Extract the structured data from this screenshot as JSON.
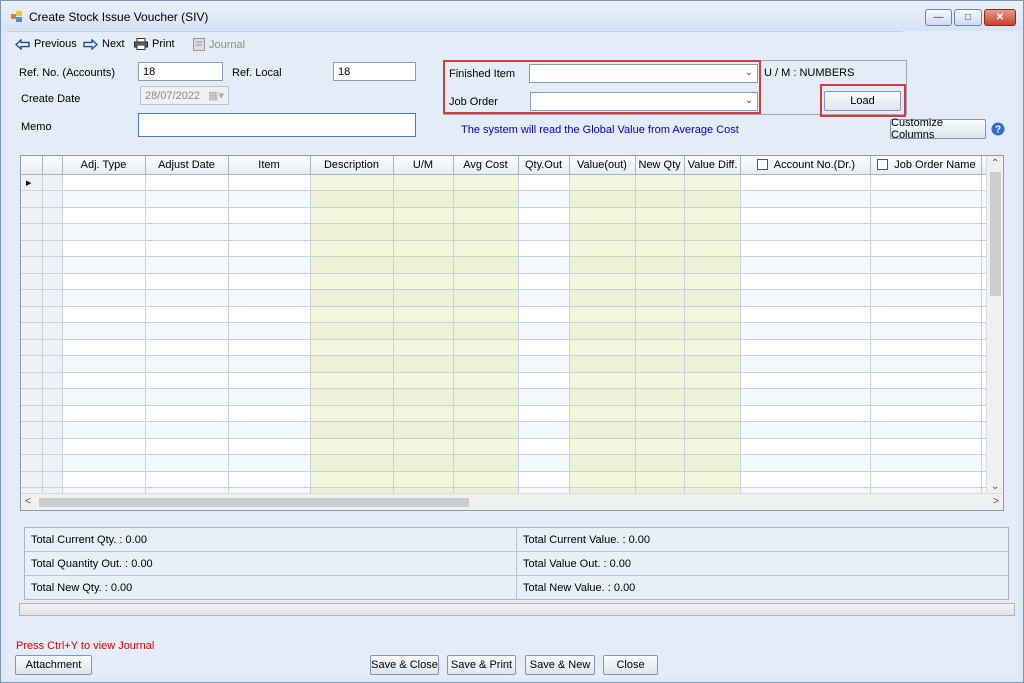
{
  "window": {
    "title": "Create Stock Issue Voucher (SIV)"
  },
  "toolbar": {
    "previous": "Previous",
    "next": "Next",
    "print": "Print",
    "journal": "Journal"
  },
  "form": {
    "ref_no_label": "Ref. No. (Accounts)",
    "ref_no_value": "18",
    "ref_local_label": "Ref. Local",
    "ref_local_value": "18",
    "create_date_label": "Create Date",
    "create_date_value": "28/07/2022",
    "memo_label": "Memo",
    "memo_value": "",
    "finished_item_label": "Finished Item",
    "finished_item_value": "",
    "job_order_label": "Job Order",
    "job_order_value": "",
    "um_text": "U / M : NUMBERS",
    "load_button": "Load",
    "info_text": "The system will read the Global Value from Average Cost",
    "customize_columns": "Customize Columns"
  },
  "grid": {
    "columns": [
      "",
      "",
      "Adj. Type",
      "Adjust Date",
      "Item",
      "Description",
      "U/M",
      "Avg Cost",
      "Qty.Out",
      "Value(out)",
      "New Qty",
      "Value Diff.",
      "Account No.(Dr.)",
      "Job Order Name",
      ""
    ],
    "row_count": 20
  },
  "totals": {
    "current_qty": "Total Current Qty. : 0.00",
    "quantity_out": "Total Quantity Out. : 0.00",
    "new_qty": "Total New Qty. : 0.00",
    "current_value": "Total Current Value. : 0.00",
    "value_out": "Total Value Out. : 0.00",
    "new_value": "Total New Value. : 0.00"
  },
  "footer": {
    "hint": "Press Ctrl+Y to view Journal",
    "attachment": "Attachment",
    "save_close": "Save & Close",
    "save_print": "Save & Print",
    "save_new": "Save & New",
    "close": "Close"
  },
  "colors": {
    "highlight_red": "#d9393b",
    "info_blue": "#0000cc",
    "hint_red": "#e00000",
    "tint_column": "#f3f5dc"
  }
}
